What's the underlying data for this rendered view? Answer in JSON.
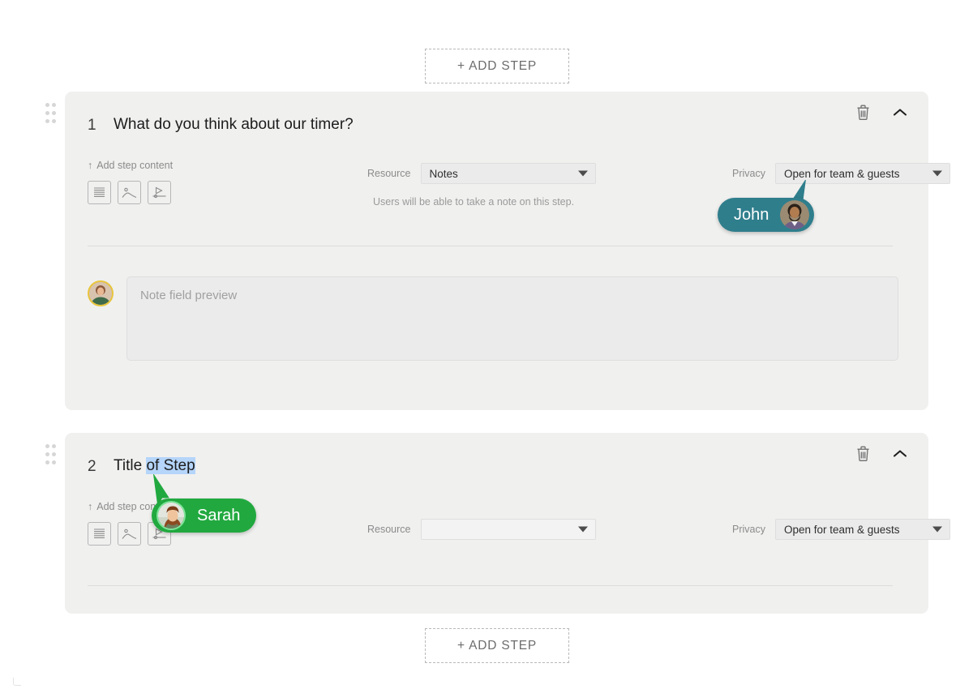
{
  "colors": {
    "card_bg": "#f0f0ef",
    "page_bg": "#ffffff",
    "john_accent": "#2f7e8c",
    "sarah_accent": "#21a93f",
    "selection_highlight": "#b5d5fa",
    "avatar_ring": "#e8c53c"
  },
  "add_step": {
    "top_label": "+ ADD STEP",
    "bottom_label": "+ ADD STEP"
  },
  "steps": [
    {
      "number": "1",
      "title": "What do you think about our timer?",
      "drag_handle_name": "drag-handle",
      "delete_icon": "trash-icon",
      "collapse_icon": "chevron-up-icon",
      "add_content": {
        "label": "Add step content",
        "arrow_glyph": "↑",
        "icons": [
          "text-content-icon",
          "image-content-icon",
          "video-content-icon"
        ]
      },
      "resource": {
        "label": "Resource",
        "value": "Notes",
        "hint": "Users will be able to take a note on this step."
      },
      "privacy": {
        "label": "Privacy",
        "value": "Open for team & guests"
      },
      "note_preview": {
        "placeholder": "Note field preview",
        "avatar_name": "sarah-avatar"
      }
    },
    {
      "number": "2",
      "title_plain": "Title ",
      "title_selected": "of Step",
      "drag_handle_name": "drag-handle",
      "delete_icon": "trash-icon",
      "collapse_icon": "chevron-up-icon",
      "add_content": {
        "label": "Add step content",
        "arrow_glyph": "↑",
        "icons": [
          "text-content-icon",
          "image-content-icon",
          "video-content-icon"
        ]
      },
      "resource": {
        "label": "Resource",
        "value": ""
      },
      "privacy": {
        "label": "Privacy",
        "value": "Open for team & guests"
      }
    }
  ],
  "cursors": [
    {
      "name": "John",
      "color": "#2f7e8c"
    },
    {
      "name": "Sarah",
      "color": "#21a93f"
    }
  ]
}
